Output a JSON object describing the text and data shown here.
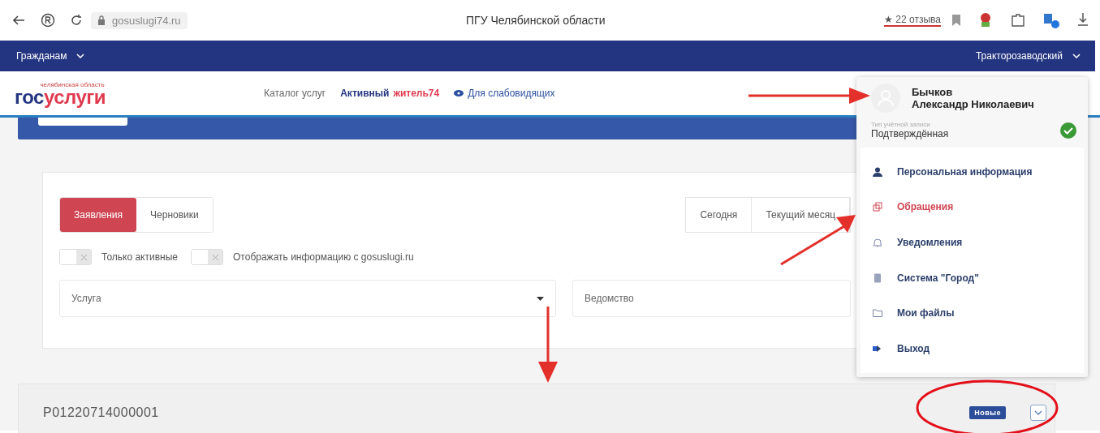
{
  "browser": {
    "url": "gosuslugi74.ru",
    "title": "ПГУ Челябинской области",
    "reviews": "★ 22 отзыва"
  },
  "nav": {
    "menu": "Гражданам",
    "district": "Тракторозаводский"
  },
  "header": {
    "logo_caption": "челябинская область",
    "logo_left": "гос",
    "logo_right": "услуги",
    "links": [
      {
        "kind": "plain",
        "text": "Каталог услуг"
      },
      {
        "kind": "split",
        "text": "Активный",
        "accent": "житель74"
      },
      {
        "kind": "eye",
        "text": "Для слабовидящих"
      }
    ]
  },
  "filters": {
    "tabs": [
      {
        "label": "Заявления",
        "selected": true
      },
      {
        "label": "Черновики",
        "selected": false
      }
    ],
    "periods": [
      "Сегодня",
      "Текущий месяц"
    ],
    "toggles": [
      {
        "label": "Только активные",
        "on": false
      },
      {
        "label": "Отображать информацию с gosuslugi.ru",
        "on": false
      }
    ],
    "selects": [
      {
        "placeholder": "Услуга",
        "caret": true
      },
      {
        "placeholder": "Ведомство",
        "caret": false
      }
    ]
  },
  "applications": [
    {
      "number": "P01220714000001",
      "status": "Новые"
    }
  ],
  "profile": {
    "surname": "Бычков",
    "name": "Александр Николаевич",
    "account_label": "Тип учётной записи",
    "account_type": "Подтверждённая",
    "verified": true,
    "menu": [
      {
        "label": "Персональная информация",
        "kind": "person",
        "selected": false
      },
      {
        "label": "Обращения",
        "kind": "copy",
        "selected": true
      },
      {
        "label": "Уведомления",
        "kind": "bell",
        "selected": false
      },
      {
        "label": "Система \"Город\"",
        "kind": "tablet",
        "selected": false
      },
      {
        "label": "Мои файлы",
        "kind": "folder",
        "selected": false
      },
      {
        "label": "Выход",
        "kind": "exit",
        "selected": false
      }
    ]
  }
}
